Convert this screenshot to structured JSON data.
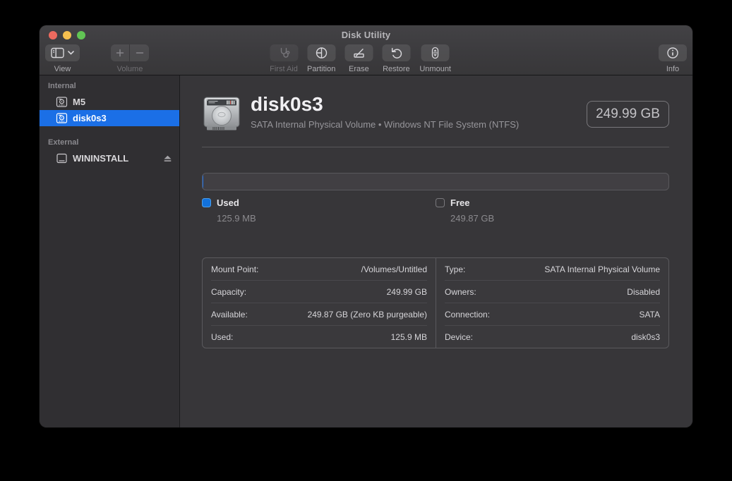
{
  "window": {
    "title": "Disk Utility"
  },
  "toolbar": {
    "view_label": "View",
    "volume_label": "Volume",
    "first_aid_label": "First Aid",
    "partition_label": "Partition",
    "erase_label": "Erase",
    "restore_label": "Restore",
    "unmount_label": "Unmount",
    "info_label": "Info"
  },
  "sidebar": {
    "sections": [
      {
        "title": "Internal",
        "items": [
          {
            "name": "M5"
          },
          {
            "name": "disk0s3"
          }
        ]
      },
      {
        "title": "External",
        "items": [
          {
            "name": "WININSTALL"
          }
        ]
      }
    ]
  },
  "main": {
    "title": "disk0s3",
    "subtitle": "SATA Internal Physical Volume • Windows NT File System (NTFS)",
    "capacity_badge": "249.99 GB",
    "usage": {
      "used_label": "Used",
      "used_value": "125.9 MB",
      "free_label": "Free",
      "free_value": "249.87 GB",
      "used_fraction": 0.0005
    },
    "details": {
      "left": [
        {
          "label": "Mount Point:",
          "value": "/Volumes/Untitled"
        },
        {
          "label": "Capacity:",
          "value": "249.99 GB"
        },
        {
          "label": "Available:",
          "value": "249.87 GB (Zero KB purgeable)"
        },
        {
          "label": "Used:",
          "value": "125.9 MB"
        }
      ],
      "right": [
        {
          "label": "Type:",
          "value": "SATA Internal Physical Volume"
        },
        {
          "label": "Owners:",
          "value": "Disabled"
        },
        {
          "label": "Connection:",
          "value": "SATA"
        },
        {
          "label": "Device:",
          "value": "disk0s3"
        }
      ]
    }
  },
  "colors": {
    "accent_blue": "#1b6fe6",
    "used_swatch": "#1272dd",
    "traffic_red": "#ed6a5f",
    "traffic_yellow": "#f5bf4f",
    "traffic_green": "#61c454"
  }
}
